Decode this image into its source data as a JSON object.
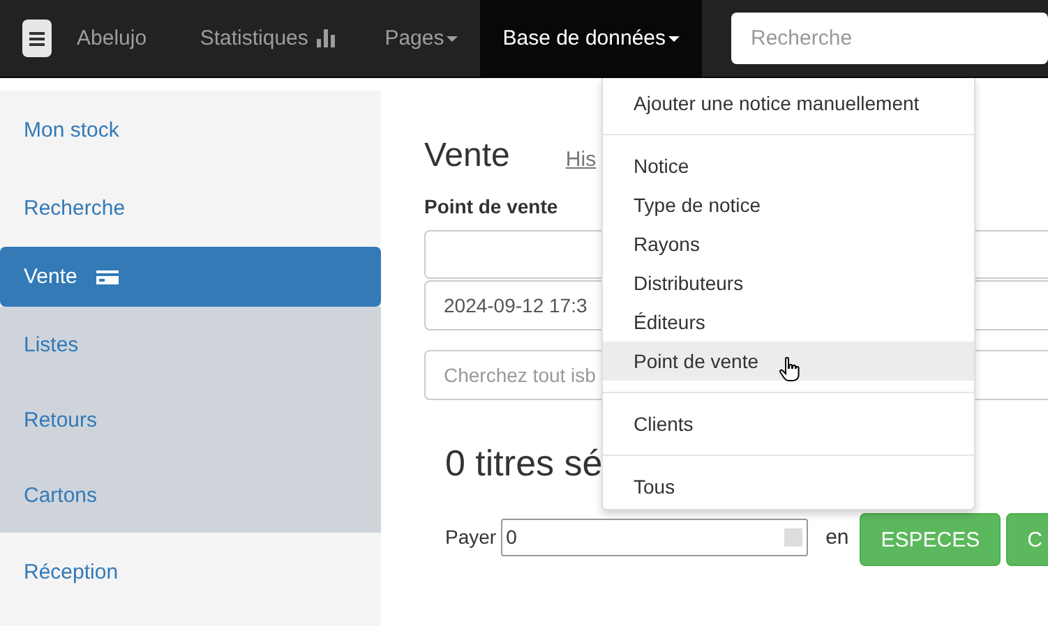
{
  "navbar": {
    "brand": "Abelujo",
    "items": [
      {
        "label": "Statistiques",
        "kind": "chart",
        "selected": false
      },
      {
        "label": "Pages",
        "kind": "caret",
        "selected": false
      },
      {
        "label": "Base de données",
        "kind": "caret",
        "selected": true
      }
    ],
    "search": {
      "placeholder": "Recherche"
    }
  },
  "sidebar": {
    "items": [
      {
        "label": "Mon stock",
        "selected": false,
        "kind": "plain"
      },
      {
        "label": "Recherche",
        "selected": false,
        "kind": "plain"
      },
      {
        "label": "Vente",
        "selected": true,
        "kind": "card",
        "children": [
          {
            "label": "Listes"
          },
          {
            "label": "Retours"
          },
          {
            "label": "Cartons"
          }
        ]
      },
      {
        "label": "Réception",
        "selected": false,
        "kind": "plain"
      }
    ]
  },
  "main": {
    "title": "Vente",
    "link": "His",
    "label": "Point de vente",
    "date": "2024-09-12 17:3",
    "search_placeholder": "Cherchez tout isb",
    "heading": "0 titres sé",
    "pay_label": "Payer",
    "pay_value": "0",
    "in_label": "en",
    "buttons": [
      "ESPECES",
      "C"
    ]
  },
  "dropdown": {
    "groups": [
      [
        {
          "label": "Ajouter une notice manuellement",
          "selected": false
        }
      ],
      [
        {
          "label": "Notice",
          "selected": false
        },
        {
          "label": "Type de notice",
          "selected": false
        },
        {
          "label": "Rayons",
          "selected": false
        },
        {
          "label": "Distributeurs",
          "selected": false
        },
        {
          "label": "Éditeurs",
          "selected": false
        },
        {
          "label": "Point de vente",
          "selected": true
        }
      ],
      [
        {
          "label": "Clients",
          "selected": false
        }
      ],
      [
        {
          "label": "Tous",
          "selected": false
        }
      ]
    ]
  }
}
